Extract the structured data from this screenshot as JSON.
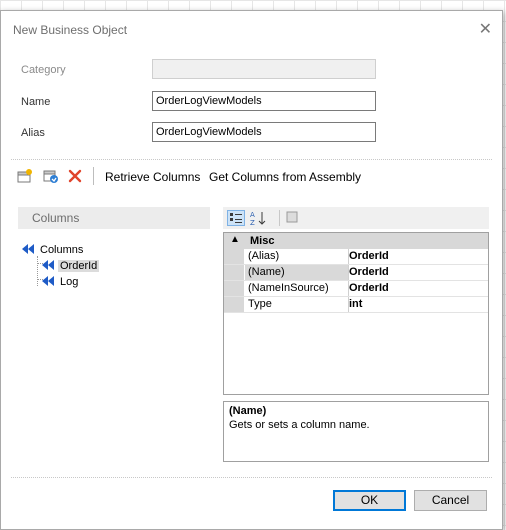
{
  "dialog": {
    "title": "New Business Object",
    "close_glyph": "✕"
  },
  "form": {
    "category_label": "Category",
    "category_value": "",
    "name_label": "Name",
    "name_value": "OrderLogViewModels",
    "alias_label": "Alias",
    "alias_value": "OrderLogViewModels"
  },
  "toolbar": {
    "icons": [
      "add-column-icon",
      "refresh-column-icon",
      "delete-icon"
    ],
    "retrieve_label": "Retrieve Columns",
    "assembly_label": "Get Columns from Assembly"
  },
  "columns_panel": {
    "header": "Columns",
    "tree": {
      "root": "Columns",
      "children": [
        "OrderId",
        "Log"
      ],
      "selected": "OrderId"
    }
  },
  "property_grid": {
    "category": "Misc",
    "rows": [
      {
        "name": "(Alias)",
        "value": "OrderId"
      },
      {
        "name": "(Name)",
        "value": "OrderId"
      },
      {
        "name": "(NameInSource)",
        "value": "OrderId"
      },
      {
        "name": "Type",
        "value": "int"
      }
    ],
    "selected_row": "(Name)",
    "description_title": "(Name)",
    "description_text": "Gets or sets a column name."
  },
  "buttons": {
    "ok": "OK",
    "cancel": "Cancel"
  },
  "colors": {
    "accent": "#0078d7",
    "tree_arrow": "#1e5bc6",
    "delete": "#e0442b"
  }
}
